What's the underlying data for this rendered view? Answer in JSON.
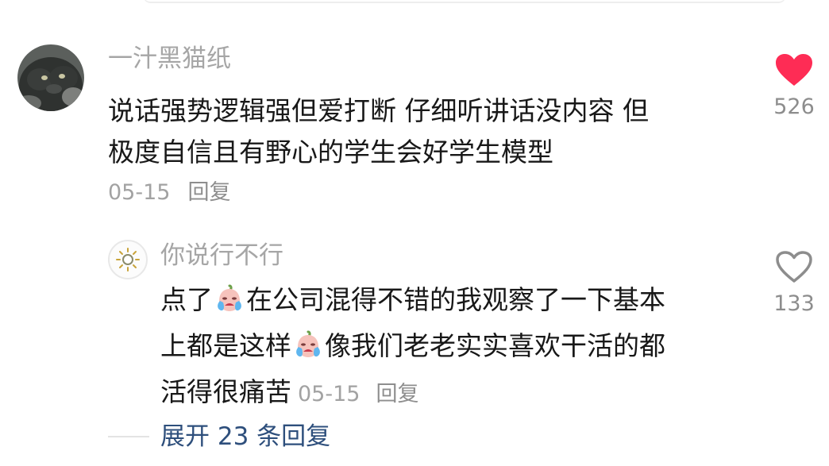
{
  "comment": {
    "username": "一汁黑猫纸",
    "text_lines": [
      "说话强势逻辑强但爱打断 仔细听讲话没内容 但",
      "极度自信且有野心的学生会好学生模型"
    ],
    "date": "05-15",
    "reply_label": "回复",
    "like_count": "526",
    "liked": true,
    "avatar_icon": "black-cat-avatar",
    "heart_color": "#fe2c55"
  },
  "reply": {
    "username": "你说行不行",
    "avatar_icon": "sun-icon",
    "segments": {
      "line1_a": "点了",
      "line1_b": "在公司混得不错的我观察了一下基本",
      "line2_a": "上都是这样",
      "line2_b": "像我们老老实实喜欢干活的都",
      "line3_a": "活得很痛苦"
    },
    "emoji_icon": "crying-face-icon",
    "date": "05-15",
    "reply_label": "回复",
    "like_count": "133",
    "liked": false
  },
  "expand": {
    "label": "展开 23 条回复"
  }
}
